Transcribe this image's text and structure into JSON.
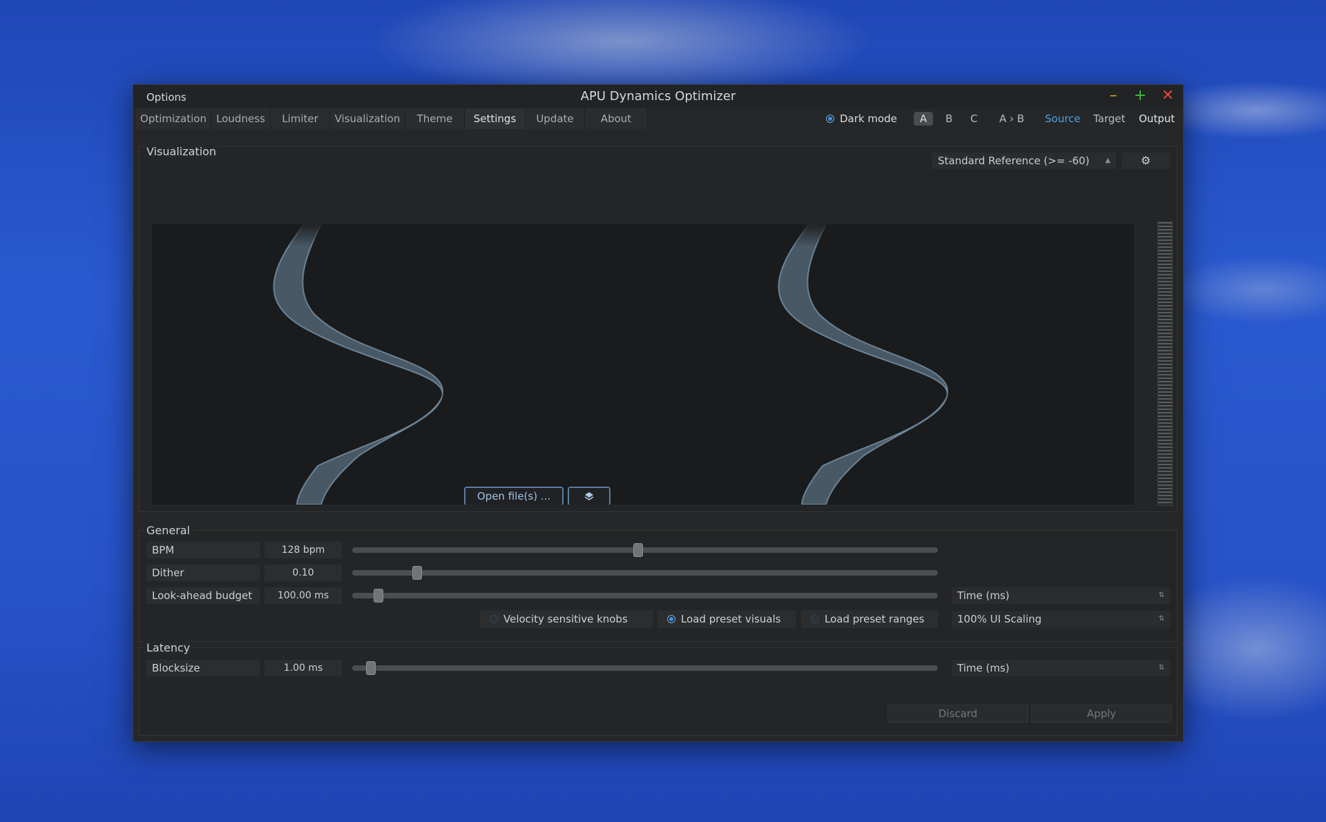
{
  "window": {
    "title": "APU Dynamics Optimizer",
    "options_label": "Options",
    "controls": {
      "minimize": "–",
      "maximize": "+",
      "close": "✕"
    }
  },
  "tabs": [
    {
      "label": "Optimization"
    },
    {
      "label": "Loudness"
    },
    {
      "label": "Limiter"
    },
    {
      "label": "Visualization"
    },
    {
      "label": "Theme"
    },
    {
      "label": "Settings",
      "active": true
    },
    {
      "label": "Update"
    },
    {
      "label": "About"
    }
  ],
  "header_right": {
    "dark_mode_label": "Dark mode",
    "dark_mode_on": true,
    "ab": [
      "A",
      "B",
      "C",
      "A › B"
    ],
    "modes": [
      "Source",
      "Target",
      "Output"
    ]
  },
  "visualization": {
    "title": "Visualization",
    "reference_select": "Standard Reference (>= -60)",
    "open_files_button": "Open file(s) ...",
    "layers_icon": "layers-icon",
    "gear_icon": "gear-icon"
  },
  "general": {
    "title": "General",
    "rows": [
      {
        "label": "BPM",
        "value": "128 bpm",
        "slider": 0.485
      },
      {
        "label": "Dither",
        "value": "0.10",
        "slider": 0.1
      },
      {
        "label": "Look-ahead budget",
        "value": "100.00 ms",
        "slider": 0.035,
        "unit_select": "Time (ms)"
      }
    ],
    "checks": [
      {
        "label": "Velocity sensitive knobs",
        "on": false
      },
      {
        "label": "Load preset visuals",
        "on": true
      },
      {
        "label": "Load preset ranges",
        "on": false
      }
    ],
    "scaling_select": "100% UI Scaling"
  },
  "latency": {
    "title": "Latency",
    "rows": [
      {
        "label": "Blocksize",
        "value": "1.00 ms",
        "slider": 0.02,
        "unit_select": "Time (ms)"
      }
    ]
  },
  "footer": {
    "discard": "Discard",
    "apply": "Apply"
  },
  "colors": {
    "accent": "#4a9ce0",
    "panel": "#262728",
    "viz_bg": "#1a1b1c",
    "wave": "#6f8ba3"
  }
}
